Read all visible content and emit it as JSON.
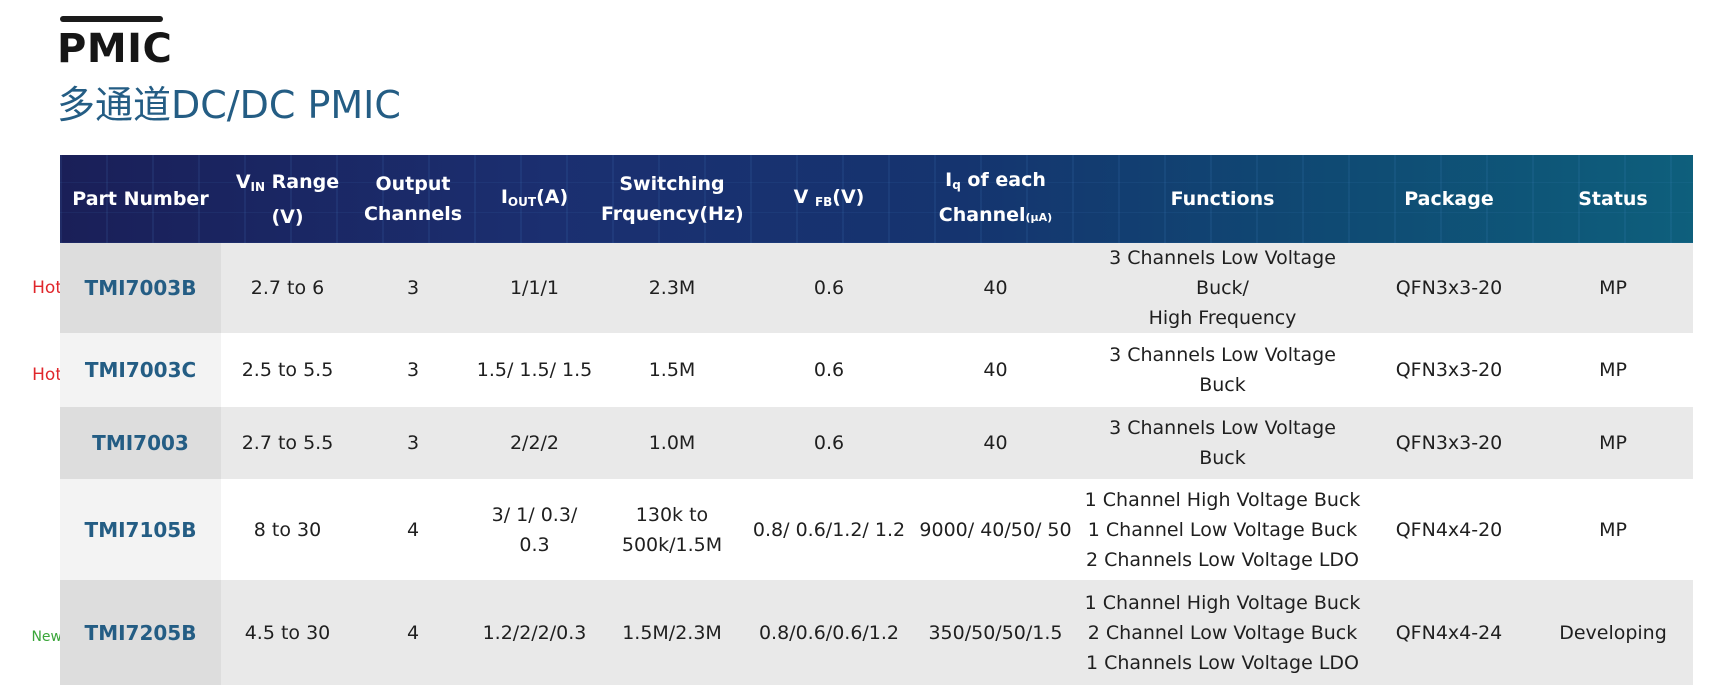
{
  "header": {
    "title": "PMIC",
    "subtitle": "多通道DC/DC PMIC"
  },
  "table": {
    "columns": [
      {
        "label": "Part Number"
      },
      {
        "pre": "V",
        "sub": "IN",
        "post": " Range",
        "line2": "(V)"
      },
      {
        "line1": "Output",
        "line2": "Channels"
      },
      {
        "pre": "I",
        "sub": "OUT",
        "post": "(A)"
      },
      {
        "line1": "Switching",
        "line2": "Frquency(Hz)"
      },
      {
        "pre": "V ",
        "sub": "FB",
        "post": "(V)"
      },
      {
        "pre": "I",
        "sub": "q",
        "post": " of each",
        "line2": "Channel",
        "line2_sub": "(μA)"
      },
      {
        "label": "Functions"
      },
      {
        "label": "Package"
      },
      {
        "label": "Status"
      }
    ],
    "rows": [
      {
        "tag": "Hot",
        "part": "TMI7003B",
        "vin": "2.7 to 6",
        "channels": "3",
        "iout": "1/1/1",
        "freq": [
          "2.3M"
        ],
        "vfb": "0.6",
        "iq": "40",
        "functions": [
          "3 Channels Low Voltage Buck/",
          "High Frequency"
        ],
        "package": "QFN3x3-20",
        "status": "MP"
      },
      {
        "tag": "Hot",
        "part": "TMI7003C",
        "vin": "2.5 to 5.5",
        "channels": "3",
        "iout": "1.5/ 1.5/ 1.5",
        "freq": [
          "1.5M"
        ],
        "vfb": "0.6",
        "iq": "40",
        "functions": [
          "3 Channels Low Voltage Buck"
        ],
        "package": "QFN3x3-20",
        "status": "MP"
      },
      {
        "tag": "",
        "part": "TMI7003",
        "vin": "2.7 to 5.5",
        "channels": "3",
        "iout": "2/2/2",
        "freq": [
          "1.0M"
        ],
        "vfb": "0.6",
        "iq": "40",
        "functions": [
          "3 Channels Low Voltage Buck"
        ],
        "package": "QFN3x3-20",
        "status": "MP"
      },
      {
        "tag": "",
        "part": "TMI7105B",
        "vin": "8 to 30",
        "channels": "4",
        "iout": "3/ 1/ 0.3/ 0.3",
        "freq": [
          "130k to",
          "500k/1.5M"
        ],
        "vfb": "0.8/ 0.6/1.2/ 1.2",
        "iq": "9000/ 40/50/ 50",
        "functions": [
          "1 Channel High Voltage Buck",
          "1 Channel Low Voltage Buck",
          "2 Channels Low Voltage LDO"
        ],
        "package": "QFN4x4-20",
        "status": "MP"
      },
      {
        "tag": "New",
        "part": "TMI7205B",
        "vin": "4.5 to 30",
        "channels": "4",
        "iout": "1.2/2/2/0.3",
        "freq": [
          "1.5M/2.3M"
        ],
        "vfb": "0.8/0.6/0.6/1.2",
        "iq": "350/50/50/1.5",
        "functions": [
          "1 Channel High Voltage Buck",
          "2 Channel Low Voltage Buck",
          "1 Channels Low Voltage LDO"
        ],
        "package": "QFN4x4-24",
        "status": "Developing"
      }
    ]
  }
}
